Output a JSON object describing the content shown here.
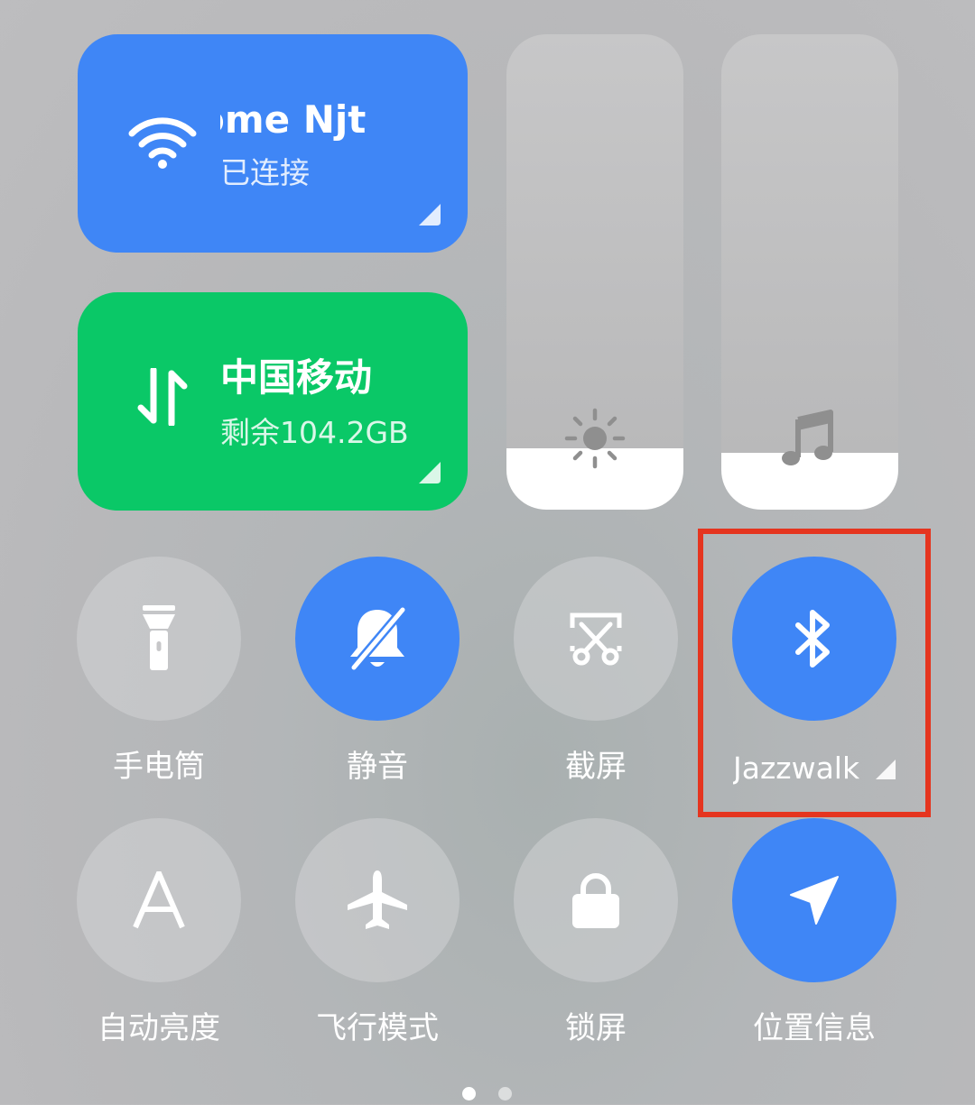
{
  "wifi_tile": {
    "network_name": "ome      Njt",
    "status": "已连接",
    "color": "#3f86f6"
  },
  "data_tile": {
    "carrier": "中国移动",
    "remaining": "剩余104.2GB",
    "color": "#0ac867"
  },
  "sliders": {
    "brightness": {
      "icon": "sun-icon",
      "level": 0.13
    },
    "volume": {
      "icon": "music-note-icon",
      "level": 0.12
    }
  },
  "toggles": [
    {
      "id": "flashlight",
      "label": "手电筒",
      "icon": "flashlight-icon",
      "on": false
    },
    {
      "id": "silent",
      "label": "静音",
      "icon": "bell-off-icon",
      "on": true
    },
    {
      "id": "screenshot",
      "label": "截屏",
      "icon": "screenshot-icon",
      "on": false
    },
    {
      "id": "bluetooth",
      "label": "Jazzwalk",
      "icon": "bluetooth-icon",
      "on": true
    },
    {
      "id": "auto-brightness",
      "label": "自动亮度",
      "icon": "auto-brightness-icon",
      "on": false
    },
    {
      "id": "airplane",
      "label": "飞行模式",
      "icon": "airplane-icon",
      "on": false
    },
    {
      "id": "lock-screen",
      "label": "锁屏",
      "icon": "lock-icon",
      "on": false
    },
    {
      "id": "location",
      "label": "位置信息",
      "icon": "location-arrow-icon",
      "on": true
    }
  ],
  "pager": {
    "page_count": 2,
    "current_page": 1
  },
  "colors": {
    "accent": "#3f86f6",
    "mobile_data": "#0ac867",
    "highlight": "#e5351f"
  }
}
